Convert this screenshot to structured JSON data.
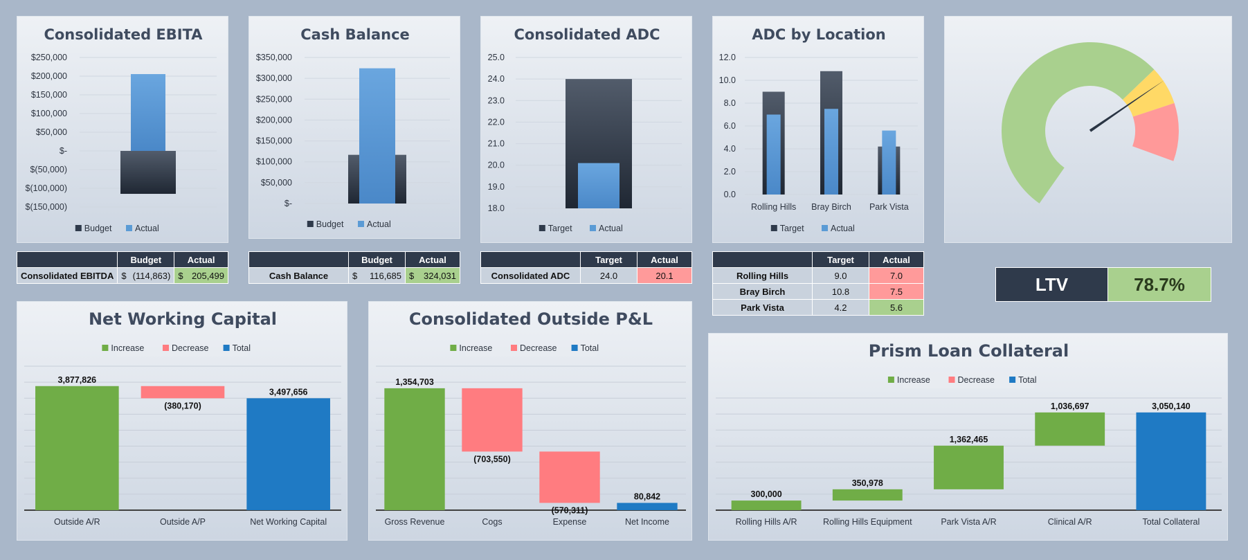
{
  "colors": {
    "budget": "#3c4554",
    "actual": "#5b9bd5",
    "increase": "#70ad47",
    "decrease": "#ff7c80",
    "total": "#1f7ac4",
    "good": "#a9d08e",
    "bad": "#ff9a9a",
    "gauge_green": "#a9d08e",
    "gauge_yellow": "#ffd966",
    "gauge_red": "#ff9999"
  },
  "chart_data": [
    {
      "id": "ebita",
      "type": "bar",
      "title": "Consolidated EBITA",
      "categories": [
        ""
      ],
      "series": [
        {
          "name": "Budget",
          "values": [
            -114863
          ]
        },
        {
          "name": "Actual",
          "values": [
            205499
          ]
        }
      ],
      "ylim": [
        -150000,
        250000
      ],
      "yticks": [
        -150000,
        -100000,
        -50000,
        0,
        50000,
        100000,
        150000,
        200000,
        250000
      ],
      "ytick_labels": [
        "$(150,000)",
        "$(100,000)",
        "$(50,000)",
        "$-",
        "$50,000",
        "$100,000",
        "$150,000",
        "$200,000",
        "$250,000"
      ],
      "legend": [
        "Budget",
        "Actual"
      ]
    },
    {
      "id": "cash",
      "type": "bar",
      "title": "Cash Balance",
      "categories": [
        ""
      ],
      "series": [
        {
          "name": "Budget",
          "values": [
            116685
          ]
        },
        {
          "name": "Actual",
          "values": [
            324031
          ]
        }
      ],
      "ylim": [
        0,
        350000
      ],
      "yticks": [
        0,
        50000,
        100000,
        150000,
        200000,
        250000,
        300000,
        350000
      ],
      "ytick_labels": [
        "$-",
        "$50,000",
        "$100,000",
        "$150,000",
        "$200,000",
        "$250,000",
        "$300,000",
        "$350,000"
      ],
      "legend": [
        "Budget",
        "Actual"
      ]
    },
    {
      "id": "adc",
      "type": "bar",
      "title": "Consolidated ADC",
      "categories": [
        ""
      ],
      "series": [
        {
          "name": "Target",
          "values": [
            24.0
          ]
        },
        {
          "name": "Actual",
          "values": [
            20.1
          ]
        }
      ],
      "ylim": [
        18,
        25
      ],
      "yticks": [
        18,
        19,
        20,
        21,
        22,
        23,
        24,
        25
      ],
      "ytick_labels": [
        "18.0",
        "19.0",
        "20.0",
        "21.0",
        "22.0",
        "23.0",
        "24.0",
        "25.0"
      ],
      "legend": [
        "Target",
        "Actual"
      ]
    },
    {
      "id": "adcloc",
      "type": "bar",
      "title": "ADC by Location",
      "categories": [
        "Rolling Hills",
        "Bray Birch",
        "Park Vista"
      ],
      "series": [
        {
          "name": "Target",
          "values": [
            9.0,
            10.8,
            4.2
          ]
        },
        {
          "name": "Actual",
          "values": [
            7.0,
            7.5,
            5.6
          ]
        }
      ],
      "ylim": [
        0,
        12
      ],
      "yticks": [
        0,
        2,
        4,
        6,
        8,
        10,
        12
      ],
      "ytick_labels": [
        "0.0",
        "2.0",
        "4.0",
        "6.0",
        "8.0",
        "10.0",
        "12.0"
      ],
      "legend": [
        "Target",
        "Actual"
      ]
    },
    {
      "id": "gauge",
      "type": "pie",
      "title": "",
      "segments": [
        {
          "name": "green",
          "value": 75
        },
        {
          "name": "yellow",
          "value": 10
        },
        {
          "name": "red",
          "value": 15
        }
      ],
      "needle_value": 78.7
    },
    {
      "id": "nwc",
      "type": "bar",
      "title": "Net Working Capital",
      "categories": [
        "Outside A/R",
        "Outside A/P",
        "Net Working Capital"
      ],
      "values": [
        3877826,
        -380170,
        3497656
      ],
      "kinds": [
        "increase",
        "decrease",
        "total"
      ],
      "data_labels": [
        "3,877,826",
        "(380,170)",
        "3,497,656"
      ],
      "ylim": [
        0,
        4500000
      ],
      "legend": [
        "Increase",
        "Decrease",
        "Total"
      ]
    },
    {
      "id": "opl",
      "type": "bar",
      "title": "Consolidated Outside P&L",
      "categories": [
        "Gross Revenue",
        "Cogs",
        "Expense",
        "Net Income"
      ],
      "values": [
        1354703,
        -703550,
        -570311,
        80842
      ],
      "kinds": [
        "increase",
        "decrease",
        "decrease",
        "total"
      ],
      "data_labels": [
        "1,354,703",
        "(703,550)",
        "(570,311)",
        "80,842"
      ],
      "ylim": [
        0,
        1600000
      ],
      "legend": [
        "Increase",
        "Decrease",
        "Total"
      ]
    },
    {
      "id": "prism",
      "type": "bar",
      "title": "Prism Loan Collateral",
      "categories": [
        "Rolling Hills A/R",
        "Rolling Hills  Equipment",
        "Park Vista A/R",
        "Clinical A/R",
        "Total Collateral"
      ],
      "values": [
        300000,
        350978,
        1362465,
        1036697,
        3050140
      ],
      "kinds": [
        "increase",
        "increase",
        "increase",
        "increase",
        "total"
      ],
      "data_labels": [
        "300,000",
        "350,978",
        "1,362,465",
        "1,036,697",
        "3,050,140"
      ],
      "ylim": [
        0,
        3500000
      ],
      "legend": [
        "Increase",
        "Decrease",
        "Total"
      ]
    }
  ],
  "tables": {
    "ebitda": {
      "headers": [
        "",
        "Budget",
        "Actual"
      ],
      "row_label": "Consolidated EBITDA",
      "budget": "(114,863)",
      "actual": "205,499",
      "currency": "$"
    },
    "cash": {
      "headers": [
        "",
        "Budget",
        "Actual"
      ],
      "row_label": "Cash Balance",
      "budget": "116,685",
      "actual": "324,031",
      "currency": "$"
    },
    "adc": {
      "headers": [
        "",
        "Target",
        "Actual"
      ],
      "row_label": "Consolidated ADC",
      "target": "24.0",
      "actual": "20.1"
    },
    "adcloc": {
      "headers": [
        "",
        "Target",
        "Actual"
      ],
      "rows": [
        {
          "label": "Rolling Hills",
          "target": "9.0",
          "actual": "7.0"
        },
        {
          "label": "Bray Birch",
          "target": "10.8",
          "actual": "7.5"
        },
        {
          "label": "Park Vista",
          "target": "4.2",
          "actual": "5.6"
        }
      ]
    }
  },
  "ltv": {
    "label": "LTV",
    "value": "78.7%"
  }
}
